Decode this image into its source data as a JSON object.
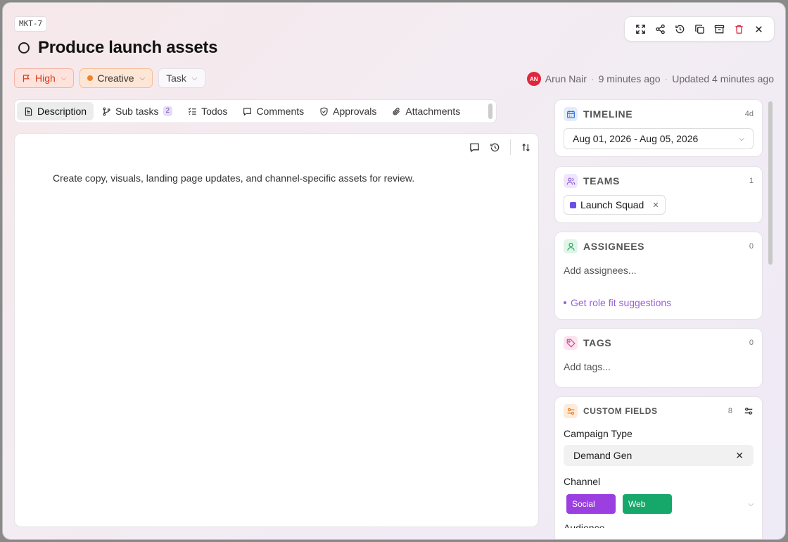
{
  "task": {
    "id": "MKT-7",
    "title": "Produce launch assets"
  },
  "chips": {
    "priority": "High",
    "category": "Creative",
    "type": "Task"
  },
  "meta": {
    "avatar_initials": "AN",
    "author": "Arun Nair",
    "created": "9 minutes ago",
    "updated": "Updated 4 minutes ago",
    "separator": "·"
  },
  "tabs": [
    {
      "label": "Description",
      "active": true
    },
    {
      "label": "Sub tasks",
      "count": "2"
    },
    {
      "label": "Todos"
    },
    {
      "label": "Comments"
    },
    {
      "label": "Approvals"
    },
    {
      "label": "Attachments"
    }
  ],
  "editor": {
    "text": "Create copy, visuals, landing page updates, and channel-specific assets for review."
  },
  "timeline": {
    "title": "TIMELINE",
    "count": "4d",
    "range": "Aug 01, 2026 - Aug 05, 2026"
  },
  "teams": {
    "title": "TEAMS",
    "count": "1",
    "team": "Launch Squad"
  },
  "assignees": {
    "title": "ASSIGNEES",
    "count": "0",
    "placeholder": "Add assignees...",
    "suggest": "Get role fit suggestions"
  },
  "tags": {
    "title": "TAGS",
    "count": "0",
    "placeholder": "Add tags..."
  },
  "custom_fields": {
    "title": "CUSTOM FIELDS",
    "count": "8",
    "campaign_label": "Campaign Type",
    "campaign_value": "Demand Gen",
    "channel_label": "Channel",
    "channels": [
      "Social",
      "Web"
    ],
    "next_label": "Audience"
  },
  "colors": {
    "priority": "#d9371c",
    "category_dot": "#f0822b",
    "team": "#6b4ee6",
    "social": "#9b3fe0",
    "web": "#16a86a",
    "suggest": "#9b5fd6"
  }
}
